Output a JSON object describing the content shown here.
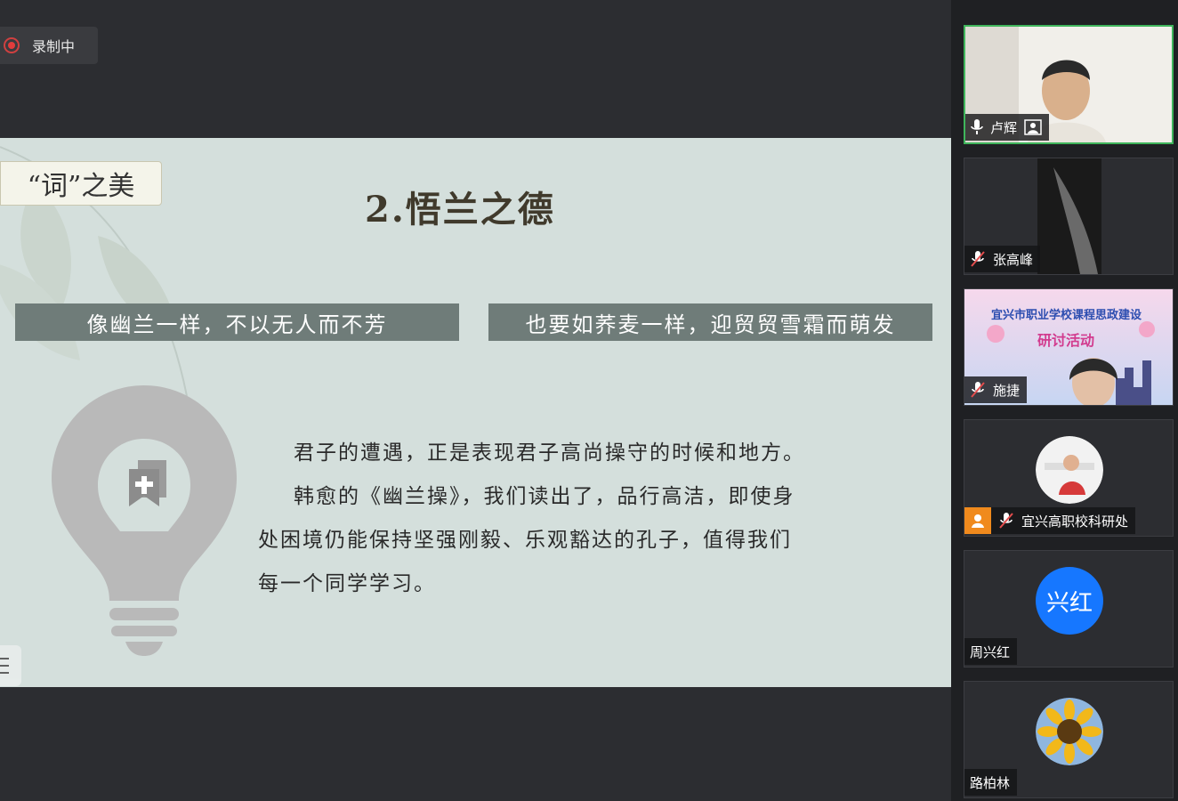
{
  "recording": {
    "label": "录制中"
  },
  "slide": {
    "tag": "“词”之美",
    "title": "2.悟兰之德",
    "banner_left": "像幽兰一样，不以无人而不芳",
    "banner_right": "也要如荞麦一样，迎贸贸雪霜而萌发",
    "paragraphs": [
      "君子的遭遇，正是表现君子高尚操守的时候和地方。",
      "韩愈的《幽兰操》，我们读出了，品行高洁，即使身",
      "处困境仍能保持坚强刚毅、乐观豁达的孔子，值得我们",
      "每一个同学学习。"
    ]
  },
  "participants": [
    {
      "name": "卢辉",
      "mic": "on",
      "camera": "on",
      "active": true
    },
    {
      "name": "张高峰",
      "mic": "muted",
      "camera": "on"
    },
    {
      "name": "施捷",
      "mic": "muted",
      "camera": "on",
      "background_text": [
        "宜兴市职业学校课程思政建设",
        "研讨活动"
      ]
    },
    {
      "name": "宜兴高职校科研处",
      "mic": "muted",
      "camera": "off"
    },
    {
      "name": "周兴红",
      "camera": "off",
      "initials": "兴红"
    },
    {
      "name": "路柏林",
      "camera": "off"
    }
  ],
  "colors": {
    "accent_active": "#3fb55b",
    "avatar_blue": "#1677ff",
    "record_red": "#e13c3c",
    "banner": "#6f7c79"
  }
}
